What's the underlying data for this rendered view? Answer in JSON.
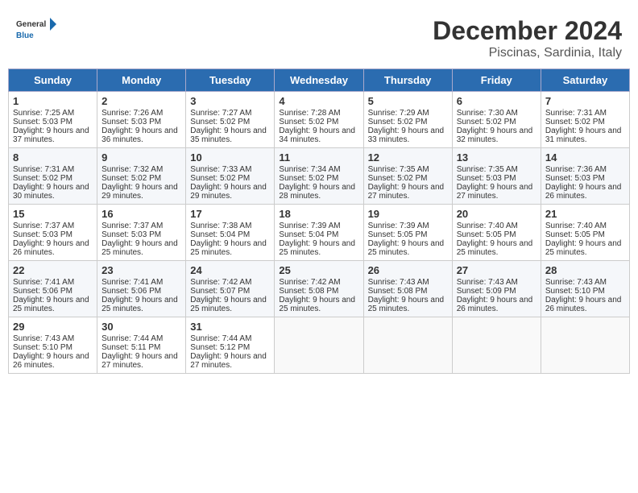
{
  "header": {
    "logo_general": "General",
    "logo_blue": "Blue",
    "month": "December 2024",
    "location": "Piscinas, Sardinia, Italy"
  },
  "weekdays": [
    "Sunday",
    "Monday",
    "Tuesday",
    "Wednesday",
    "Thursday",
    "Friday",
    "Saturday"
  ],
  "weeks": [
    [
      {
        "day": "1",
        "sunrise": "7:25 AM",
        "sunset": "5:03 PM",
        "daylight": "9 hours and 37 minutes."
      },
      {
        "day": "2",
        "sunrise": "7:26 AM",
        "sunset": "5:03 PM",
        "daylight": "9 hours and 36 minutes."
      },
      {
        "day": "3",
        "sunrise": "7:27 AM",
        "sunset": "5:02 PM",
        "daylight": "9 hours and 35 minutes."
      },
      {
        "day": "4",
        "sunrise": "7:28 AM",
        "sunset": "5:02 PM",
        "daylight": "9 hours and 34 minutes."
      },
      {
        "day": "5",
        "sunrise": "7:29 AM",
        "sunset": "5:02 PM",
        "daylight": "9 hours and 33 minutes."
      },
      {
        "day": "6",
        "sunrise": "7:30 AM",
        "sunset": "5:02 PM",
        "daylight": "9 hours and 32 minutes."
      },
      {
        "day": "7",
        "sunrise": "7:31 AM",
        "sunset": "5:02 PM",
        "daylight": "9 hours and 31 minutes."
      }
    ],
    [
      {
        "day": "8",
        "sunrise": "7:31 AM",
        "sunset": "5:02 PM",
        "daylight": "9 hours and 30 minutes."
      },
      {
        "day": "9",
        "sunrise": "7:32 AM",
        "sunset": "5:02 PM",
        "daylight": "9 hours and 29 minutes."
      },
      {
        "day": "10",
        "sunrise": "7:33 AM",
        "sunset": "5:02 PM",
        "daylight": "9 hours and 29 minutes."
      },
      {
        "day": "11",
        "sunrise": "7:34 AM",
        "sunset": "5:02 PM",
        "daylight": "9 hours and 28 minutes."
      },
      {
        "day": "12",
        "sunrise": "7:35 AM",
        "sunset": "5:02 PM",
        "daylight": "9 hours and 27 minutes."
      },
      {
        "day": "13",
        "sunrise": "7:35 AM",
        "sunset": "5:03 PM",
        "daylight": "9 hours and 27 minutes."
      },
      {
        "day": "14",
        "sunrise": "7:36 AM",
        "sunset": "5:03 PM",
        "daylight": "9 hours and 26 minutes."
      }
    ],
    [
      {
        "day": "15",
        "sunrise": "7:37 AM",
        "sunset": "5:03 PM",
        "daylight": "9 hours and 26 minutes."
      },
      {
        "day": "16",
        "sunrise": "7:37 AM",
        "sunset": "5:03 PM",
        "daylight": "9 hours and 25 minutes."
      },
      {
        "day": "17",
        "sunrise": "7:38 AM",
        "sunset": "5:04 PM",
        "daylight": "9 hours and 25 minutes."
      },
      {
        "day": "18",
        "sunrise": "7:39 AM",
        "sunset": "5:04 PM",
        "daylight": "9 hours and 25 minutes."
      },
      {
        "day": "19",
        "sunrise": "7:39 AM",
        "sunset": "5:05 PM",
        "daylight": "9 hours and 25 minutes."
      },
      {
        "day": "20",
        "sunrise": "7:40 AM",
        "sunset": "5:05 PM",
        "daylight": "9 hours and 25 minutes."
      },
      {
        "day": "21",
        "sunrise": "7:40 AM",
        "sunset": "5:05 PM",
        "daylight": "9 hours and 25 minutes."
      }
    ],
    [
      {
        "day": "22",
        "sunrise": "7:41 AM",
        "sunset": "5:06 PM",
        "daylight": "9 hours and 25 minutes."
      },
      {
        "day": "23",
        "sunrise": "7:41 AM",
        "sunset": "5:06 PM",
        "daylight": "9 hours and 25 minutes."
      },
      {
        "day": "24",
        "sunrise": "7:42 AM",
        "sunset": "5:07 PM",
        "daylight": "9 hours and 25 minutes."
      },
      {
        "day": "25",
        "sunrise": "7:42 AM",
        "sunset": "5:08 PM",
        "daylight": "9 hours and 25 minutes."
      },
      {
        "day": "26",
        "sunrise": "7:43 AM",
        "sunset": "5:08 PM",
        "daylight": "9 hours and 25 minutes."
      },
      {
        "day": "27",
        "sunrise": "7:43 AM",
        "sunset": "5:09 PM",
        "daylight": "9 hours and 26 minutes."
      },
      {
        "day": "28",
        "sunrise": "7:43 AM",
        "sunset": "5:10 PM",
        "daylight": "9 hours and 26 minutes."
      }
    ],
    [
      {
        "day": "29",
        "sunrise": "7:43 AM",
        "sunset": "5:10 PM",
        "daylight": "9 hours and 26 minutes."
      },
      {
        "day": "30",
        "sunrise": "7:44 AM",
        "sunset": "5:11 PM",
        "daylight": "9 hours and 27 minutes."
      },
      {
        "day": "31",
        "sunrise": "7:44 AM",
        "sunset": "5:12 PM",
        "daylight": "9 hours and 27 minutes."
      },
      null,
      null,
      null,
      null
    ]
  ]
}
